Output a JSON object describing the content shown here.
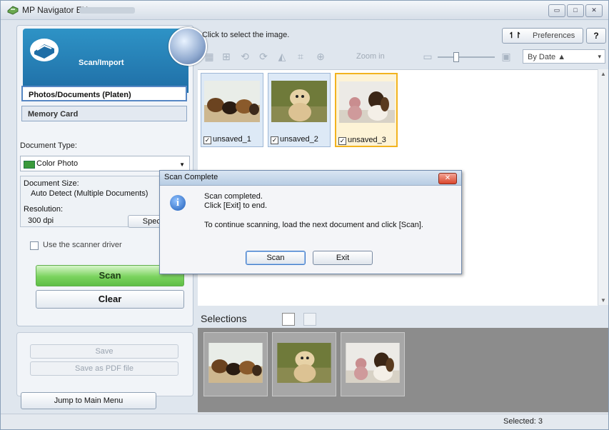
{
  "window": {
    "title": "MP Navigator EX",
    "controls": [
      "minimize",
      "maximize",
      "close"
    ]
  },
  "left": {
    "section_title": "Scan/Import",
    "tabs": [
      "Photos/Documents (Platen)",
      "Memory Card"
    ],
    "document_type_label": "Document Type:",
    "document_type_value": "Color Photo",
    "document_size_label": "Document Size:",
    "document_size_value": "Auto Detect (Multiple Documents)",
    "resolution_label": "Resolution:",
    "resolution_value": "300 dpi",
    "specify_label": "Specify...",
    "use_driver_label": "Use the scanner driver",
    "scan_label": "Scan",
    "clear_label": "Clear",
    "save_label": "Save",
    "save_pdf_label": "Save as PDF file",
    "jump_label": "Jump to Main Menu"
  },
  "right": {
    "hint": "Click to select the image.",
    "preferences_label": "Preferences",
    "help_label": "?",
    "zoom_label": "Zoom in",
    "sort_value": "By Date",
    "thumbnails": [
      {
        "name": "unsaved_1",
        "checked": true,
        "selected": false
      },
      {
        "name": "unsaved_2",
        "checked": true,
        "selected": false
      },
      {
        "name": "unsaved_3",
        "checked": true,
        "selected": true
      }
    ],
    "selections_title": "Selections",
    "status": "Selected: 3"
  },
  "dialog": {
    "title": "Scan Complete",
    "line1": "Scan completed.",
    "line2": "Click [Exit] to end.",
    "line3": "To continue scanning, load the next document and click [Scan].",
    "scan_button": "Scan",
    "exit_button": "Exit"
  },
  "colors": {
    "accent_blue": "#2e93c6",
    "scan_green": "#7ad35e",
    "selection_yellow": "#f2b31f"
  }
}
